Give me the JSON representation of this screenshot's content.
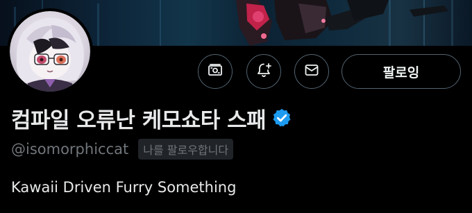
{
  "profile": {
    "display_name": "컴파일 오류난 케모쇼타 스패",
    "handle": "@isomorphiccat",
    "follows_you_badge": "나를 팔로우합니다",
    "bio": "Kawaii Driven Furry Something",
    "verified": true
  },
  "actions": {
    "follow_label": "팔로잉",
    "tip_icon": "money-icon",
    "notify_icon": "bell-plus-icon",
    "message_icon": "envelope-icon"
  },
  "colors": {
    "background": "#000000",
    "primary_text": "#e7e9ea",
    "secondary_text": "#71767b",
    "button_border": "#536471",
    "verified_badge": "#1d9bf0"
  }
}
